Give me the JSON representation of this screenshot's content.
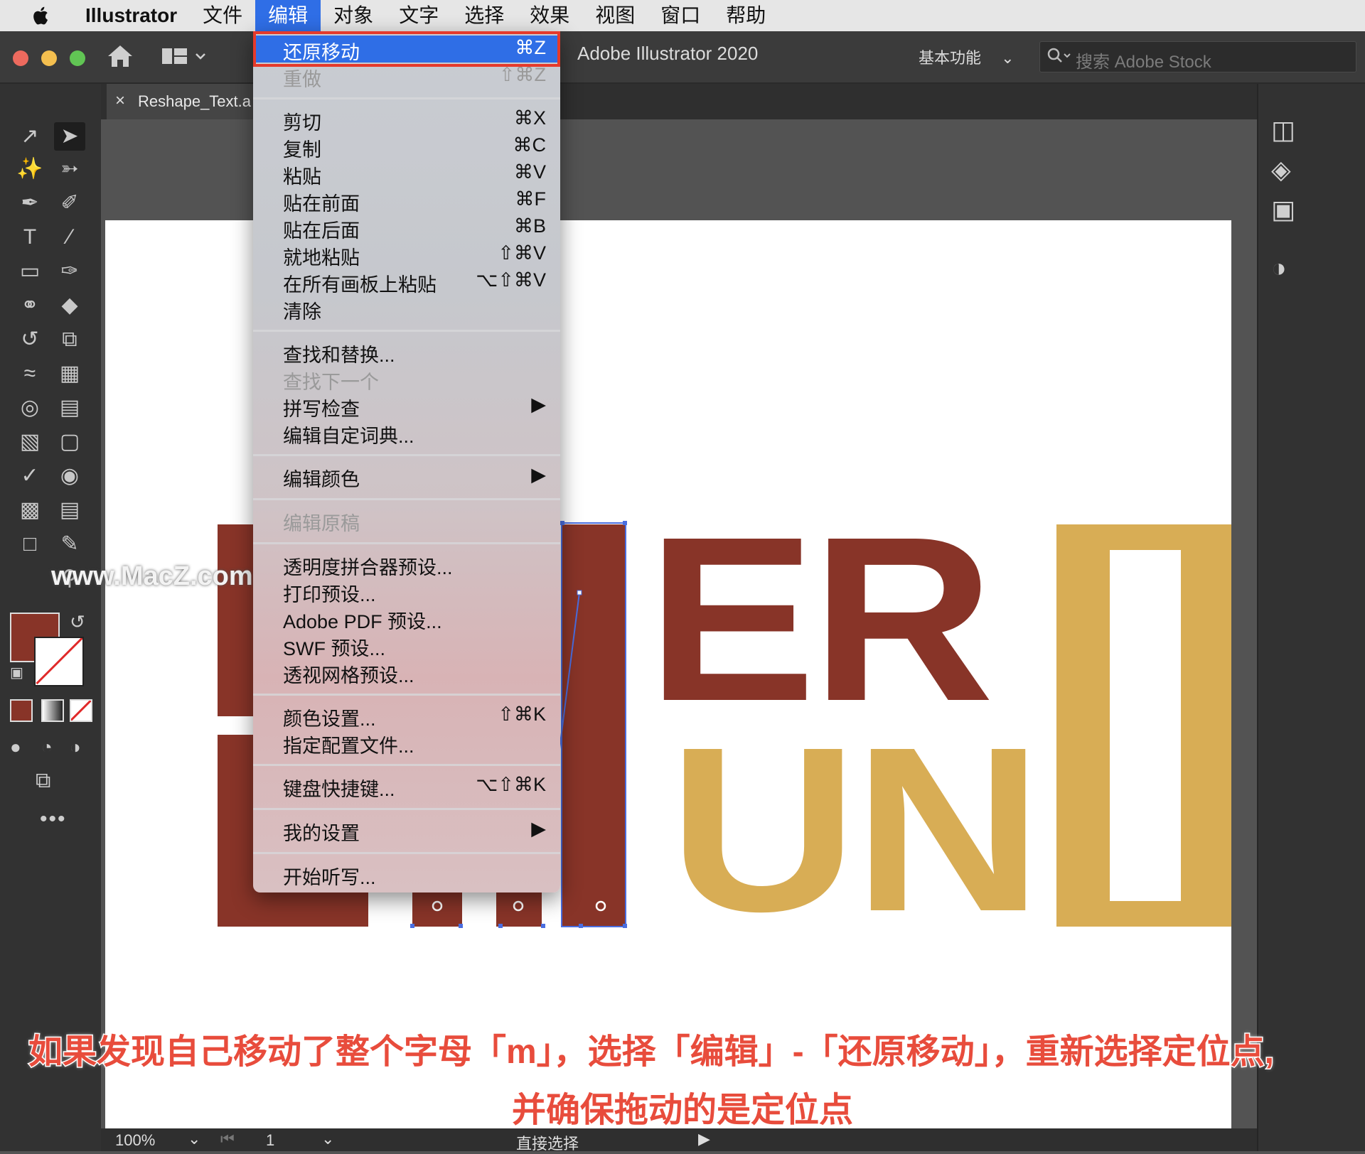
{
  "menubar": {
    "app": "Illustrator",
    "items": [
      "文件",
      "编辑",
      "对象",
      "文字",
      "选择",
      "效果",
      "视图",
      "窗口",
      "帮助"
    ],
    "active_index": 1
  },
  "appbar": {
    "title": "Adobe Illustrator 2020",
    "workspace": "基本功能",
    "search_placeholder": "搜索 Adobe Stock"
  },
  "document": {
    "tab_name": "Reshape_Text.a"
  },
  "edit_menu": {
    "items": [
      {
        "label": "还原移动",
        "shortcut": "⌘Z",
        "state": "highlighted"
      },
      {
        "label": "重做",
        "shortcut": "⇧⌘Z",
        "state": "disabled"
      },
      {
        "label": "剪切",
        "shortcut": "⌘X"
      },
      {
        "label": "复制",
        "shortcut": "⌘C"
      },
      {
        "label": "粘贴",
        "shortcut": "⌘V"
      },
      {
        "label": "贴在前面",
        "shortcut": "⌘F"
      },
      {
        "label": "贴在后面",
        "shortcut": "⌘B"
      },
      {
        "label": "就地粘贴",
        "shortcut": "⇧⌘V"
      },
      {
        "label": "在所有画板上粘贴",
        "shortcut": "⌥⇧⌘V"
      },
      {
        "label": "清除",
        "shortcut": ""
      },
      {
        "label": "查找和替换...",
        "shortcut": ""
      },
      {
        "label": "查找下一个",
        "shortcut": "",
        "state": "disabled"
      },
      {
        "label": "拼写检查",
        "shortcut": "▶"
      },
      {
        "label": "编辑自定词典...",
        "shortcut": ""
      },
      {
        "label": "编辑颜色",
        "shortcut": "▶"
      },
      {
        "label": "编辑原稿",
        "shortcut": "",
        "state": "disabled"
      },
      {
        "label": "透明度拼合器预设...",
        "shortcut": ""
      },
      {
        "label": "打印预设...",
        "shortcut": ""
      },
      {
        "label": "Adobe PDF 预设...",
        "shortcut": ""
      },
      {
        "label": "SWF 预设...",
        "shortcut": ""
      },
      {
        "label": "透视网格预设...",
        "shortcut": ""
      },
      {
        "label": "颜色设置...",
        "shortcut": "⇧⌘K"
      },
      {
        "label": "指定配置文件...",
        "shortcut": ""
      },
      {
        "label": "键盘快捷键...",
        "shortcut": "⌥⇧⌘K"
      },
      {
        "label": "我的设置",
        "shortcut": "▶"
      },
      {
        "label": "开始听写...",
        "shortcut": ""
      }
    ]
  },
  "artwork": {
    "letters_top": "ER",
    "letters_bottom": "UN"
  },
  "statusbar": {
    "zoom": "100%",
    "artboard": "1",
    "tool": "直接选择"
  },
  "watermark": "www.MacZ.com",
  "caption": {
    "line1": "如果发现自己移动了整个字母「m」，选择「编辑」-「还原移动」，重新选择定位点,",
    "line2": "并确保拖动的是定位点"
  },
  "colors": {
    "fill": "#883428",
    "gold": "#d8ad55",
    "menu_highlight": "#2f6ee6",
    "callout": "#e53a2b"
  }
}
